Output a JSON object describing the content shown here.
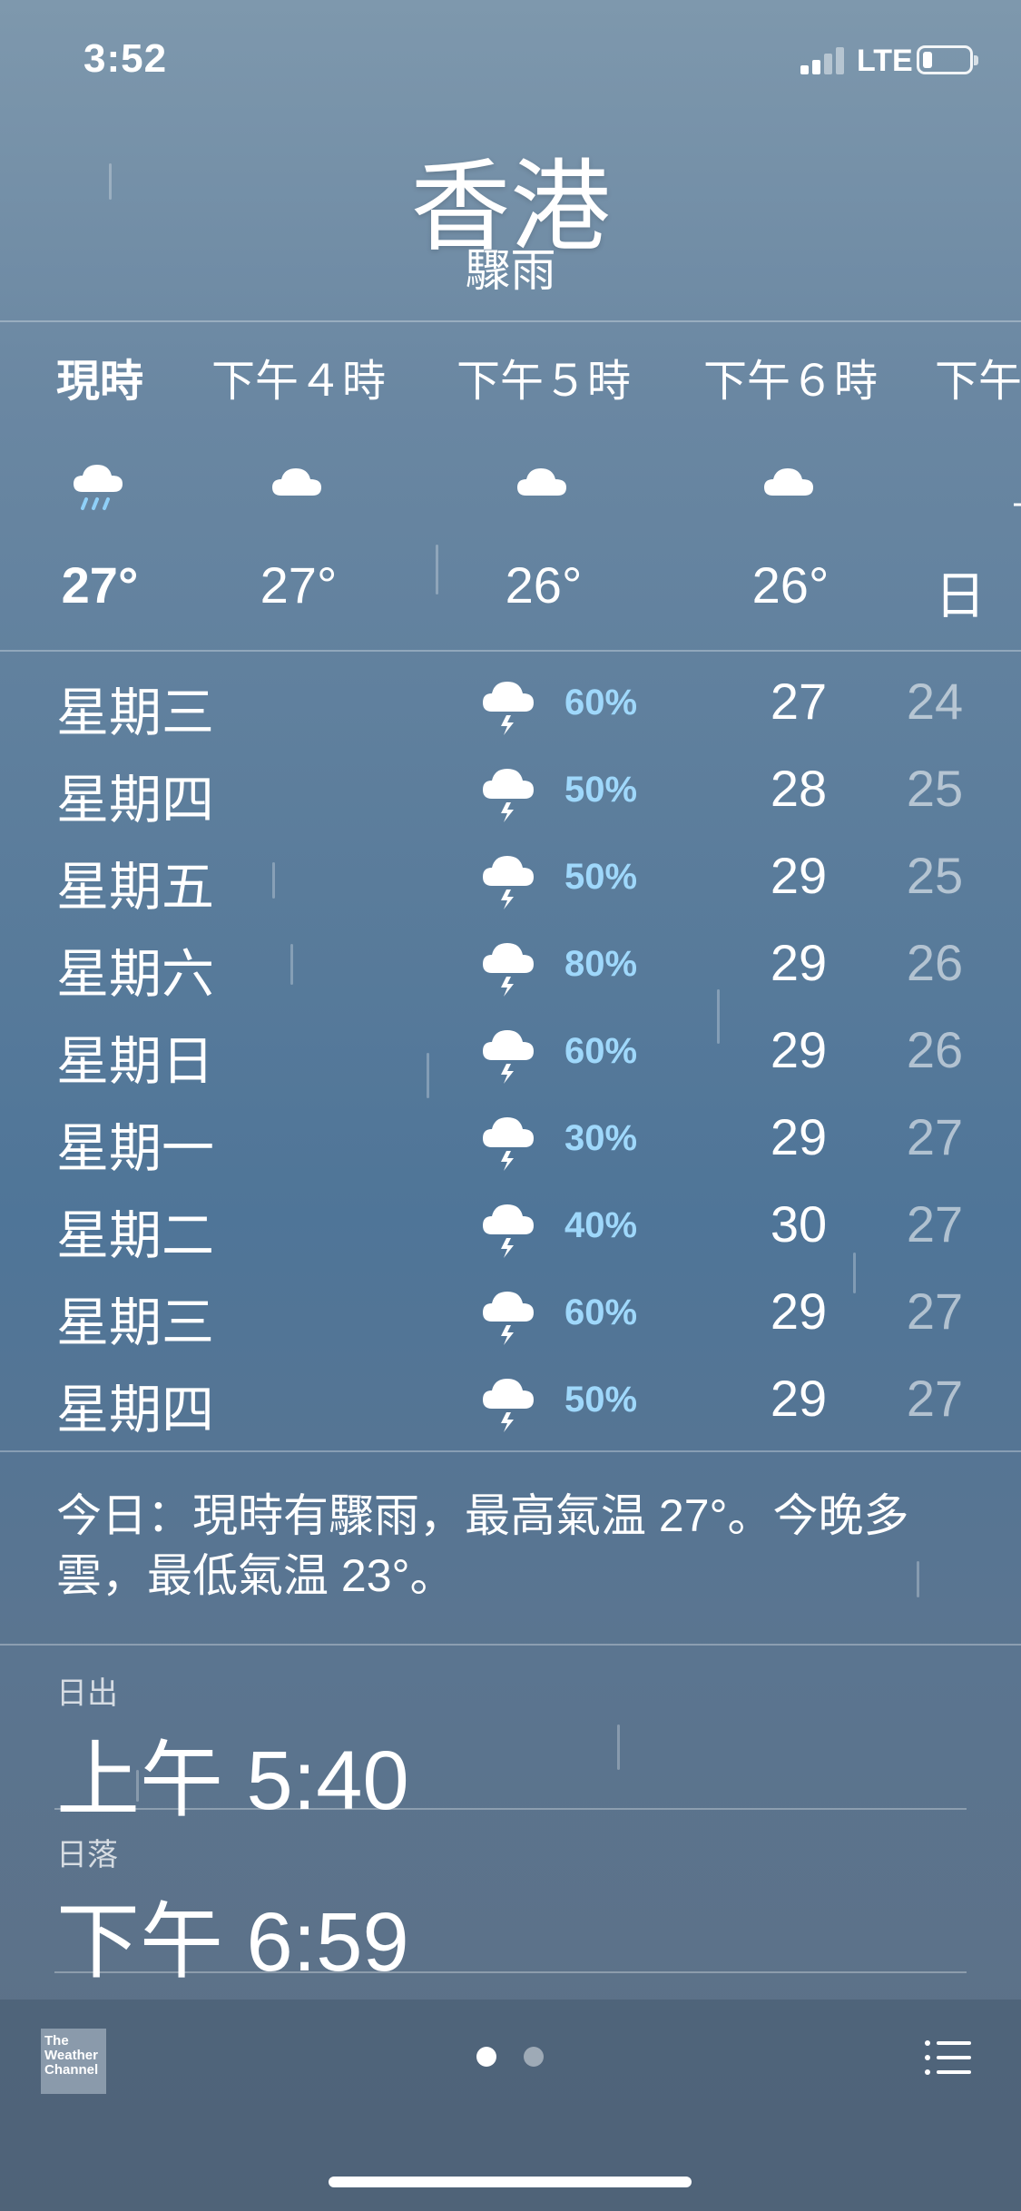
{
  "status_bar": {
    "time": "3:52",
    "network": "LTE"
  },
  "header": {
    "city": "香港",
    "condition": "驟雨"
  },
  "hourly": [
    {
      "label": "現時",
      "icon": "cloud-rain-icon",
      "temp": "27°"
    },
    {
      "label": "下午４時",
      "icon": "cloud-icon",
      "temp": "27°"
    },
    {
      "label": "下午５時",
      "icon": "cloud-icon",
      "temp": "26°"
    },
    {
      "label": "下午６時",
      "icon": "cloud-icon",
      "temp": "26°"
    },
    {
      "label": "下午",
      "icon": "sunset-icon",
      "temp": "日"
    }
  ],
  "daily": [
    {
      "day": "星期三",
      "icon": "thunderstorm-icon",
      "chance": "60%",
      "high": "27",
      "low": "24"
    },
    {
      "day": "星期四",
      "icon": "thunderstorm-icon",
      "chance": "50%",
      "high": "28",
      "low": "25"
    },
    {
      "day": "星期五",
      "icon": "thunderstorm-icon",
      "chance": "50%",
      "high": "29",
      "low": "25"
    },
    {
      "day": "星期六",
      "icon": "thunderstorm-icon",
      "chance": "80%",
      "high": "29",
      "low": "26"
    },
    {
      "day": "星期日",
      "icon": "thunderstorm-icon",
      "chance": "60%",
      "high": "29",
      "low": "26"
    },
    {
      "day": "星期一",
      "icon": "thunderstorm-icon",
      "chance": "30%",
      "high": "29",
      "low": "27"
    },
    {
      "day": "星期二",
      "icon": "thunderstorm-icon",
      "chance": "40%",
      "high": "30",
      "low": "27"
    },
    {
      "day": "星期三",
      "icon": "thunderstorm-icon",
      "chance": "60%",
      "high": "29",
      "low": "27"
    },
    {
      "day": "星期四",
      "icon": "thunderstorm-icon",
      "chance": "50%",
      "high": "29",
      "low": "27"
    }
  ],
  "summary": "今日：現時有驟雨，最高氣温 27°。今晚多雲，最低氣温 23°。",
  "details": {
    "sunrise_label": "日出",
    "sunrise_value": "上午 5:40",
    "sunset_label": "日落",
    "sunset_value": "下午 6:59"
  },
  "bottom_bar": {
    "logo_text": "The Weather Channel",
    "pages": 2,
    "current_page": 1
  },
  "colors": {
    "precip": "#9fd8fb",
    "sun": "#f6c94a"
  }
}
